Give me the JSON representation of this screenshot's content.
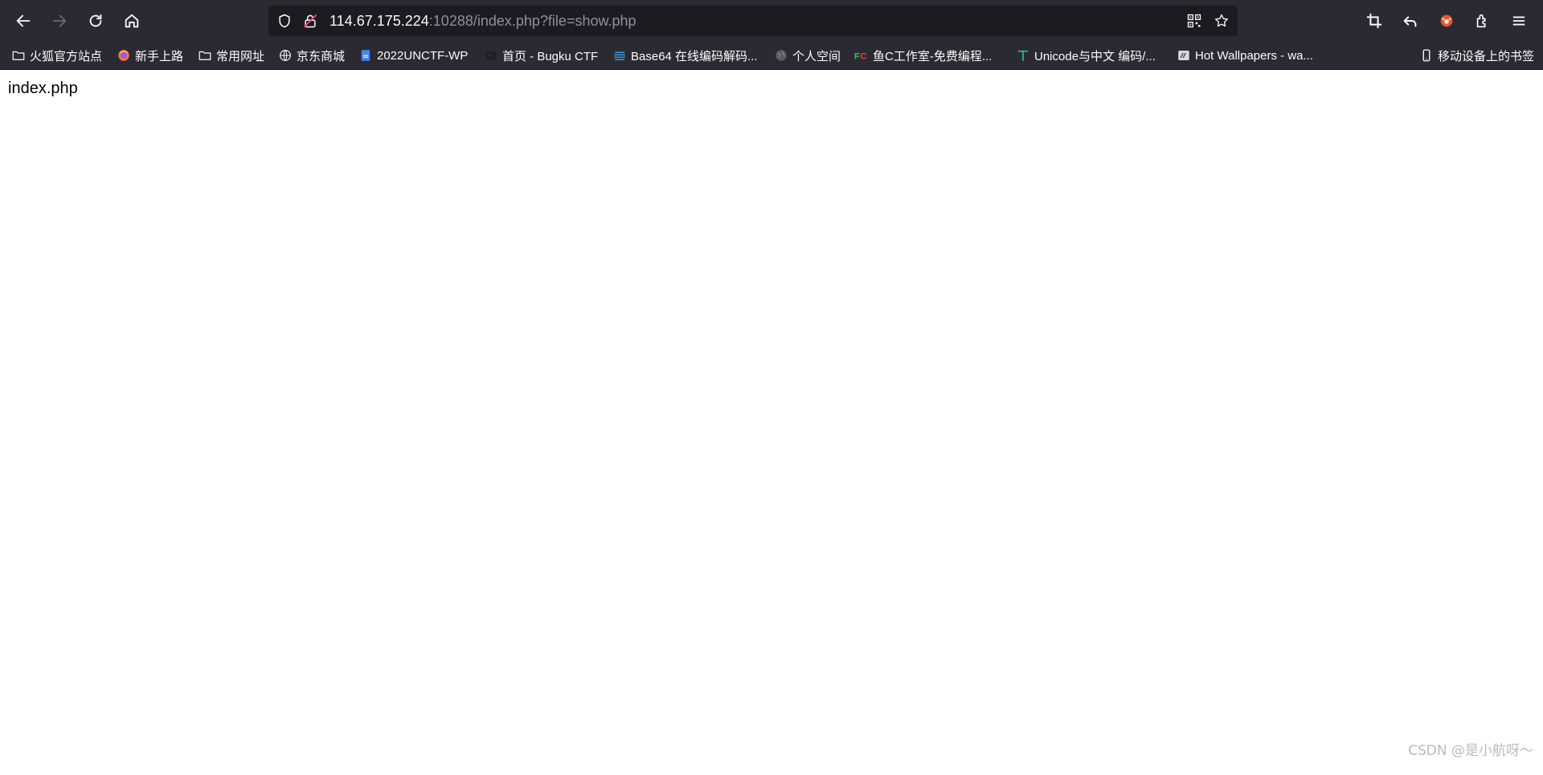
{
  "browser": {
    "url_host": "114.67.175.224",
    "url_rest": ":10288/index.php?file=show.php"
  },
  "bookmarks": [
    {
      "label": "火狐官方站点",
      "icon": "folder-icon"
    },
    {
      "label": "新手上路",
      "icon": "firefox-icon"
    },
    {
      "label": "常用网址",
      "icon": "folder-icon"
    },
    {
      "label": "京东商城",
      "icon": "globe-icon"
    },
    {
      "label": "2022UNCTF-WP",
      "icon": "doc-icon"
    },
    {
      "label": "首页 - Bugku CTF",
      "icon": "bugku-icon"
    },
    {
      "label": "Base64 在线编码解码...",
      "icon": "base64-icon"
    },
    {
      "label": "个人空间",
      "icon": "globe-gray-icon"
    },
    {
      "label": "鱼C工作室-免费编程...",
      "icon": "fc-icon"
    },
    {
      "label": "Unicode与中文 编码/...",
      "icon": "unicode-icon"
    },
    {
      "label": "Hot Wallpapers - wa...",
      "icon": "wallpaper-icon"
    },
    {
      "label": "移动设备上的书签",
      "icon": "mobile-icon"
    }
  ],
  "page": {
    "content_text": "index.php"
  },
  "watermark": "CSDN @是小航呀～",
  "colors": {
    "toolbar_bg": "#2b2a33",
    "urlbar_bg": "#1c1b22",
    "page_bg": "#ffffff"
  }
}
